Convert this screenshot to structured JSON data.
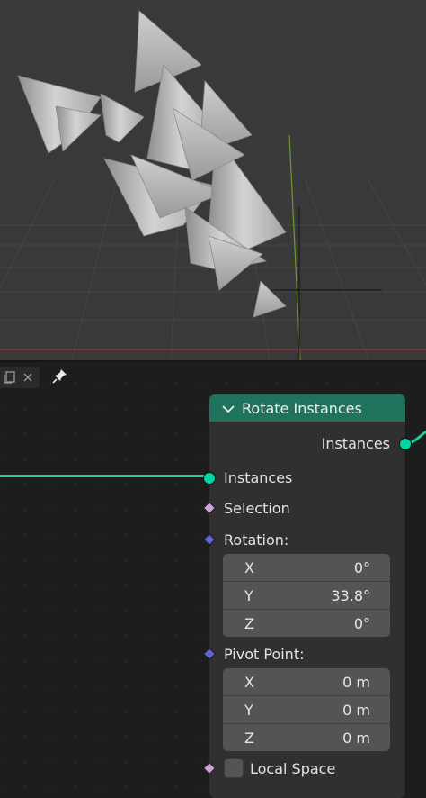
{
  "colors": {
    "node_header": "#1f735d",
    "geometry_socket": "#00d6a3",
    "selection_socket": "#cca6d6",
    "vector_socket": "#6363c7",
    "link": "#1fcf9f",
    "field_bg": "#545454"
  },
  "header_icons": [
    "copy-icon",
    "close-icon",
    "pin-icon"
  ],
  "node": {
    "title": "Rotate Instances",
    "output_label": "Instances",
    "inputs": {
      "instances_label": "Instances",
      "selection_label": "Selection",
      "rotation_label": "Rotation:",
      "rotation": [
        {
          "axis": "X",
          "value": "0°"
        },
        {
          "axis": "Y",
          "value": "33.8°"
        },
        {
          "axis": "Z",
          "value": "0°"
        }
      ],
      "pivot_label": "Pivot Point:",
      "pivot": [
        {
          "axis": "X",
          "value": "0 m"
        },
        {
          "axis": "Y",
          "value": "0 m"
        },
        {
          "axis": "Z",
          "value": "0 m"
        }
      ],
      "local_space_label": "Local Space",
      "local_space_checked": false
    }
  }
}
